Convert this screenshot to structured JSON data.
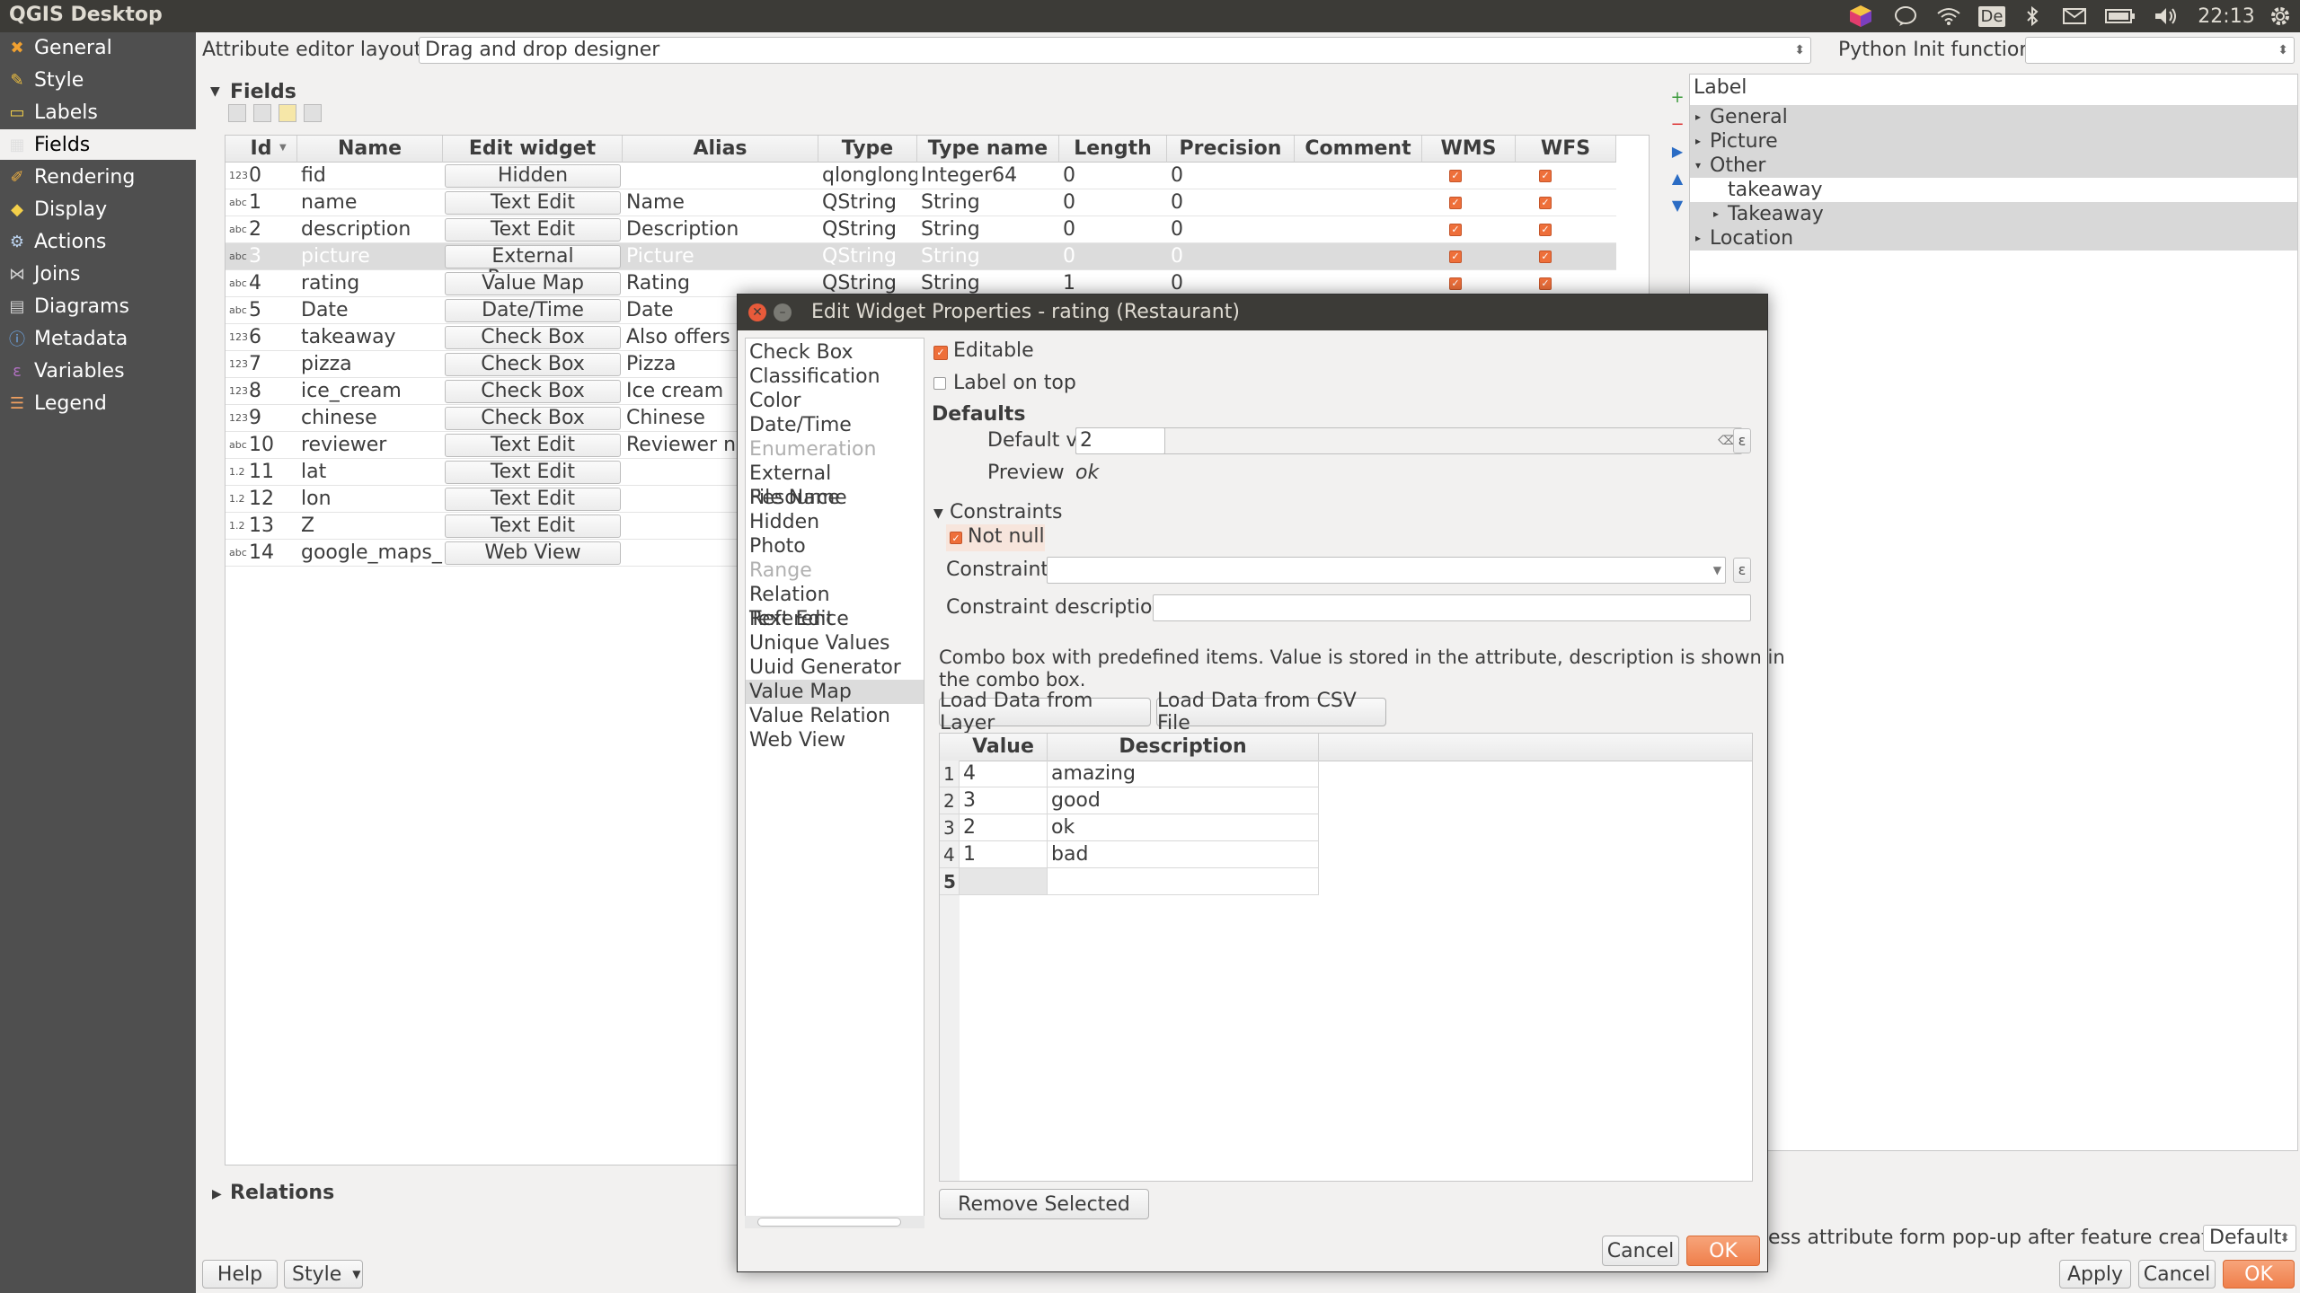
{
  "topbar": {
    "title": "QGIS Desktop",
    "time": "22:13",
    "keyboard": "De"
  },
  "sidebar": {
    "items": [
      {
        "label": "General",
        "icon": "wrench-icon"
      },
      {
        "label": "Style",
        "icon": "brush-icon"
      },
      {
        "label": "Labels",
        "icon": "labels-icon"
      },
      {
        "label": "Fields",
        "icon": "fields-icon"
      },
      {
        "label": "Rendering",
        "icon": "rendering-icon"
      },
      {
        "label": "Display",
        "icon": "speech-bubble-icon"
      },
      {
        "label": "Actions",
        "icon": "gear-icon"
      },
      {
        "label": "Joins",
        "icon": "joins-icon"
      },
      {
        "label": "Diagrams",
        "icon": "diagrams-icon"
      },
      {
        "label": "Metadata",
        "icon": "info-icon"
      },
      {
        "label": "Variables",
        "icon": "variables-icon"
      },
      {
        "label": "Legend",
        "icon": "legend-icon"
      }
    ],
    "active_index": 3
  },
  "main": {
    "layout_label": "Attribute editor layout:",
    "layout_value": "Drag and drop designer",
    "python_label": "Python Init function",
    "python_value": "",
    "fields_title": "Fields",
    "relations_title": "Relations",
    "suppress_label": "ess attribute form pop-up after feature creation",
    "suppress_value": "Default",
    "help_label": "Help",
    "style_label": "Style",
    "apply_label": "Apply",
    "cancel_label": "Cancel",
    "ok_label": "OK"
  },
  "fields_table": {
    "columns": [
      "Id",
      "Name",
      "Edit widget",
      "Alias",
      "Type",
      "Type name",
      "Length",
      "Precision",
      "Comment",
      "WMS",
      "WFS"
    ],
    "rows": [
      {
        "icon": "123",
        "id": "0",
        "name": "fid",
        "widget": "Hidden",
        "alias": "",
        "type": "qlonglong",
        "type_name": "Integer64",
        "length": "0",
        "precision": "0"
      },
      {
        "icon": "abc",
        "id": "1",
        "name": "name",
        "widget": "Text Edit",
        "alias": "Name",
        "type": "QString",
        "type_name": "String",
        "length": "0",
        "precision": "0"
      },
      {
        "icon": "abc",
        "id": "2",
        "name": "description",
        "widget": "Text Edit",
        "alias": "Description",
        "type": "QString",
        "type_name": "String",
        "length": "0",
        "precision": "0"
      },
      {
        "icon": "abc",
        "id": "3",
        "name": "picture",
        "widget": "External Resource",
        "alias": "Picture",
        "type": "QString",
        "type_name": "String",
        "length": "0",
        "precision": "0"
      },
      {
        "icon": "abc",
        "id": "4",
        "name": "rating",
        "widget": "Value Map",
        "alias": "Rating",
        "type": "QString",
        "type_name": "String",
        "length": "1",
        "precision": "0"
      },
      {
        "icon": "abc",
        "id": "5",
        "name": "Date",
        "widget": "Date/Time",
        "alias": "Date",
        "type": "",
        "type_name": "",
        "length": "",
        "precision": ""
      },
      {
        "icon": "123",
        "id": "6",
        "name": "takeaway",
        "widget": "Check Box",
        "alias": "Also offers",
        "type": "",
        "type_name": "",
        "length": "",
        "precision": ""
      },
      {
        "icon": "123",
        "id": "7",
        "name": "pizza",
        "widget": "Check Box",
        "alias": "Pizza",
        "type": "",
        "type_name": "",
        "length": "",
        "precision": ""
      },
      {
        "icon": "123",
        "id": "8",
        "name": "ice_cream",
        "widget": "Check Box",
        "alias": "Ice cream",
        "type": "",
        "type_name": "",
        "length": "",
        "precision": ""
      },
      {
        "icon": "123",
        "id": "9",
        "name": "chinese",
        "widget": "Check Box",
        "alias": "Chinese",
        "type": "",
        "type_name": "",
        "length": "",
        "precision": ""
      },
      {
        "icon": "abc",
        "id": "10",
        "name": "reviewer",
        "widget": "Text Edit",
        "alias": "Reviewer n",
        "type": "",
        "type_name": "",
        "length": "",
        "precision": ""
      },
      {
        "icon": "1.2",
        "id": "11",
        "name": "lat",
        "widget": "Text Edit",
        "alias": "",
        "type": "",
        "type_name": "",
        "length": "",
        "precision": ""
      },
      {
        "icon": "1.2",
        "id": "12",
        "name": "lon",
        "widget": "Text Edit",
        "alias": "",
        "type": "",
        "type_name": "",
        "length": "",
        "precision": ""
      },
      {
        "icon": "1.2",
        "id": "13",
        "name": "Z",
        "widget": "Text Edit",
        "alias": "",
        "type": "",
        "type_name": "",
        "length": "",
        "precision": ""
      },
      {
        "icon": "abc",
        "id": "14",
        "name": "google_maps_url",
        "widget": "Web View",
        "alias": "",
        "type": "",
        "type_name": "",
        "length": "",
        "precision": ""
      }
    ],
    "selected_index": 3
  },
  "tree": {
    "header": "Label",
    "items": [
      {
        "label": "General",
        "arrow": "▸",
        "grey": true,
        "indent": 0
      },
      {
        "label": "Picture",
        "arrow": "▸",
        "grey": true,
        "indent": 0
      },
      {
        "label": "Other",
        "arrow": "▾",
        "grey": true,
        "indent": 0
      },
      {
        "label": "takeaway",
        "arrow": "",
        "grey": false,
        "indent": 1
      },
      {
        "label": "Takeaway",
        "arrow": "▸",
        "grey": true,
        "indent": 1
      },
      {
        "label": "Location",
        "arrow": "▸",
        "grey": true,
        "indent": 0
      }
    ]
  },
  "dialog": {
    "title": "Edit Widget Properties - rating (Restaurant)",
    "widget_types": [
      {
        "label": "Check Box",
        "disabled": false
      },
      {
        "label": "Classification",
        "disabled": false
      },
      {
        "label": "Color",
        "disabled": false
      },
      {
        "label": "Date/Time",
        "disabled": false
      },
      {
        "label": "Enumeration",
        "disabled": true
      },
      {
        "label": "External Resource",
        "disabled": false
      },
      {
        "label": "File Name",
        "disabled": false
      },
      {
        "label": "Hidden",
        "disabled": false
      },
      {
        "label": "Photo",
        "disabled": false
      },
      {
        "label": "Range",
        "disabled": true
      },
      {
        "label": "Relation Reference",
        "disabled": false
      },
      {
        "label": "Text Edit",
        "disabled": false
      },
      {
        "label": "Unique Values",
        "disabled": false
      },
      {
        "label": "Uuid Generator",
        "disabled": false
      },
      {
        "label": "Value Map",
        "disabled": false
      },
      {
        "label": "Value Relation",
        "disabled": false
      },
      {
        "label": "Web View",
        "disabled": false
      }
    ],
    "selected_widget_index": 14,
    "editable_label": "Editable",
    "label_on_top": "Label on top",
    "defaults_title": "Defaults",
    "default_value_label": "Default value",
    "default_value": "2",
    "preview_label": "Preview",
    "preview_value": "ok",
    "constraints_title": "Constraints",
    "not_null_label": "Not null",
    "constraint_label": "Constraint",
    "constraint_value": "",
    "constraint_desc_label": "Constraint description",
    "constraint_desc_value": "",
    "description_line1": "Combo box with predefined items. Value is stored in the attribute, description is shown in",
    "description_line2": "the combo box.",
    "load_layer_label": "Load Data from Layer",
    "load_csv_label": "Load Data from CSV File",
    "value_map": {
      "columns": [
        "Value",
        "Description"
      ],
      "rows": [
        {
          "num": "1",
          "value": "4",
          "description": "amazing"
        },
        {
          "num": "2",
          "value": "3",
          "description": "good"
        },
        {
          "num": "3",
          "value": "2",
          "description": "ok"
        },
        {
          "num": "4",
          "value": "1",
          "description": "bad"
        },
        {
          "num": "5",
          "value": "",
          "description": ""
        }
      ]
    },
    "remove_label": "Remove Selected",
    "cancel_label": "Cancel",
    "ok_label": "OK"
  },
  "colors": {
    "accent": "#ee6f3a",
    "titlebar": "#3c3b37",
    "sidebar": "#4f4f4f"
  }
}
